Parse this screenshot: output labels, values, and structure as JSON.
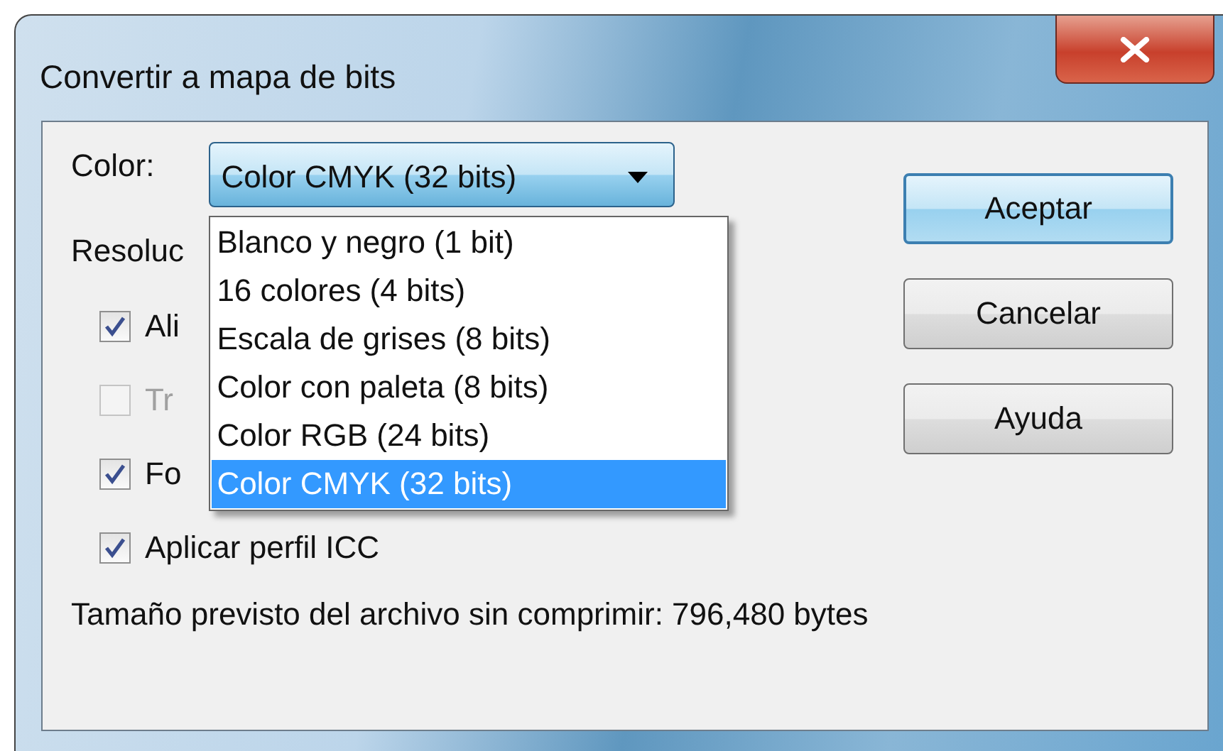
{
  "window": {
    "title": "Convertir a mapa de bits"
  },
  "color_field": {
    "label": "Color:",
    "value": "Color CMYK (32 bits)",
    "expanded": true,
    "options": [
      {
        "label": "Blanco y negro (1 bit)",
        "selected": false
      },
      {
        "label": "16 colores (4 bits)",
        "selected": false
      },
      {
        "label": "Escala de grises (8 bits)",
        "selected": false
      },
      {
        "label": "Color con paleta (8 bits)",
        "selected": false
      },
      {
        "label": "Color RGB (24 bits)",
        "selected": false
      },
      {
        "label": "Color CMYK (32 bits)",
        "selected": true
      }
    ]
  },
  "resolution_label": "Resoluc",
  "checkboxes": [
    {
      "label": "Ali",
      "checked": true,
      "disabled": false
    },
    {
      "label": "Tr",
      "checked": false,
      "disabled": true
    },
    {
      "label": "Fo",
      "checked": true,
      "disabled": false
    },
    {
      "label": "Aplicar perfil ICC",
      "checked": true,
      "disabled": false
    }
  ],
  "file_size": "Tamaño previsto del archivo sin comprimir: 796,480 bytes",
  "buttons": [
    {
      "label": "Aceptar",
      "default": true
    },
    {
      "label": "Cancelar",
      "default": false
    },
    {
      "label": "Ayuda",
      "default": false
    }
  ]
}
